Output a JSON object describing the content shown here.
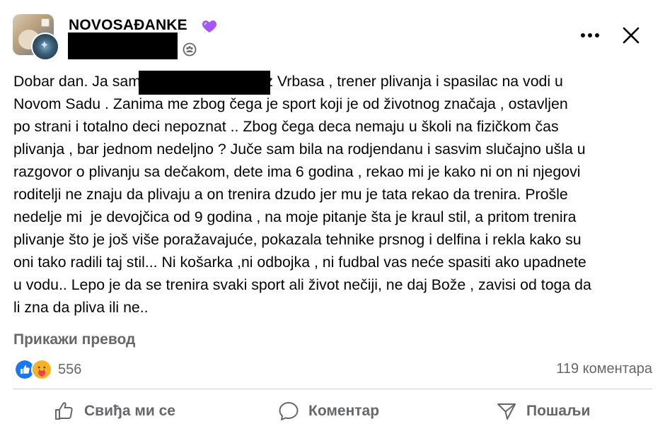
{
  "header": {
    "group_name": "NOVOSAĐANKE",
    "icons": {
      "heart": "purple-heart-icon",
      "audience": "group-audience-icon",
      "more": "more-options-icon",
      "close": "close-icon"
    }
  },
  "post": {
    "lines": [
      "Dobar dan. Ja sam                             iz Vrbasa , trener plivanja i spasilac na vodi u",
      "Novom Sadu . Zanima me zbog čega je sport koji je od životnog značaja , ostavljen",
      "po strani i totalno deci nepoznat .. Zbog čega deca nemaju u školi na fizičkom čas",
      "plivanja , bar jednom nedeljno ? Juče sam bila na rodjendanu i sasvim slučajno ušla u",
      "razgovor o plivanju sa dečakom, dete ima 6 godina , rekao mi je kako ni on ni njegovi",
      "roditelji ne znaju da plivaju a on trenira dzudo jer mu je tata rekao da trenira. Prošle",
      "nedelje mi  je devojčica od 9 godina , na moje pitanje šta je kraul stil, a pritom trenira",
      "plivanje što je još više poražavajuće, pokazala tehnike prsnog i delfina i rekla kako su",
      "oni tako radili taj stil... Ni košarka ,ni odbojka , ni fudbal vas neće spasiti ako upadnete",
      "u vodu.. Lepo je da se trenira svaki sport ali život nečiji, ne daj Bože , zavisi od toga da",
      "li zna da pliva ili ne.."
    ],
    "see_translation": "Прикажи превод"
  },
  "stats": {
    "reactions": [
      "like-reaction-icon",
      "care-reaction-icon"
    ],
    "reaction_count": "556",
    "comments": "119 коментара"
  },
  "actions": {
    "like": {
      "label": "Свиђа ми се",
      "icon": "thumbs-up-icon"
    },
    "comment": {
      "label": "Коментар",
      "icon": "comment-bubble-icon"
    },
    "share": {
      "label": "Пошаљи",
      "icon": "share-icon"
    }
  },
  "colors": {
    "text": "#050505",
    "secondary_text": "#65676b",
    "like_blue": "#1877f2",
    "heart_purple": "#a855f7",
    "divider": "#ced0d4"
  }
}
